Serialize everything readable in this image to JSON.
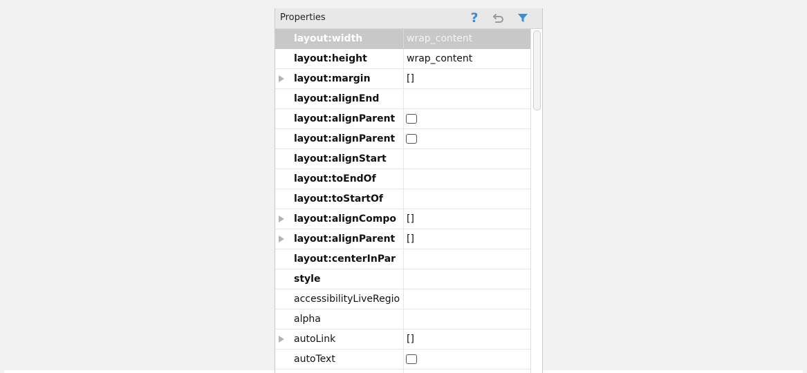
{
  "panel": {
    "title": "Properties",
    "help_glyph": "?"
  },
  "rows": [
    {
      "name": "layout:width",
      "bold": true,
      "value": "wrap_content",
      "expandable": false,
      "checkbox": false,
      "selected": true
    },
    {
      "name": "layout:height",
      "bold": true,
      "value": "wrap_content",
      "expandable": false,
      "checkbox": false
    },
    {
      "name": "layout:margin",
      "bold": true,
      "value": "[]",
      "expandable": true,
      "checkbox": false
    },
    {
      "name": "layout:alignEnd",
      "bold": true,
      "value": "",
      "expandable": false,
      "checkbox": false
    },
    {
      "name": "layout:alignParent",
      "bold": true,
      "value": "",
      "expandable": false,
      "checkbox": true
    },
    {
      "name": "layout:alignParent",
      "bold": true,
      "value": "",
      "expandable": false,
      "checkbox": true
    },
    {
      "name": "layout:alignStart",
      "bold": true,
      "value": "",
      "expandable": false,
      "checkbox": false
    },
    {
      "name": "layout:toEndOf",
      "bold": true,
      "value": "",
      "expandable": false,
      "checkbox": false
    },
    {
      "name": "layout:toStartOf",
      "bold": true,
      "value": "",
      "expandable": false,
      "checkbox": false
    },
    {
      "name": "layout:alignCompo",
      "bold": true,
      "value": "[]",
      "expandable": true,
      "checkbox": false
    },
    {
      "name": "layout:alignParent",
      "bold": true,
      "value": "[]",
      "expandable": true,
      "checkbox": false
    },
    {
      "name": "layout:centerInPar",
      "bold": true,
      "value": "",
      "expandable": false,
      "checkbox": false
    },
    {
      "name": "style",
      "bold": true,
      "value": "",
      "expandable": false,
      "checkbox": false
    },
    {
      "name": "accessibilityLiveRegio",
      "bold": false,
      "value": "",
      "expandable": false,
      "checkbox": false
    },
    {
      "name": "alpha",
      "bold": false,
      "value": "",
      "expandable": false,
      "checkbox": false
    },
    {
      "name": "autoLink",
      "bold": false,
      "value": "[]",
      "expandable": true,
      "checkbox": false
    },
    {
      "name": "autoText",
      "bold": false,
      "value": "",
      "expandable": false,
      "checkbox": true
    },
    {
      "name": "",
      "bold": false,
      "value": "",
      "expandable": false,
      "checkbox": false
    }
  ],
  "colors": {
    "accent": "#3d8ed1",
    "selection": "#c8c8c8",
    "header_bg": "#e8e8e8"
  }
}
